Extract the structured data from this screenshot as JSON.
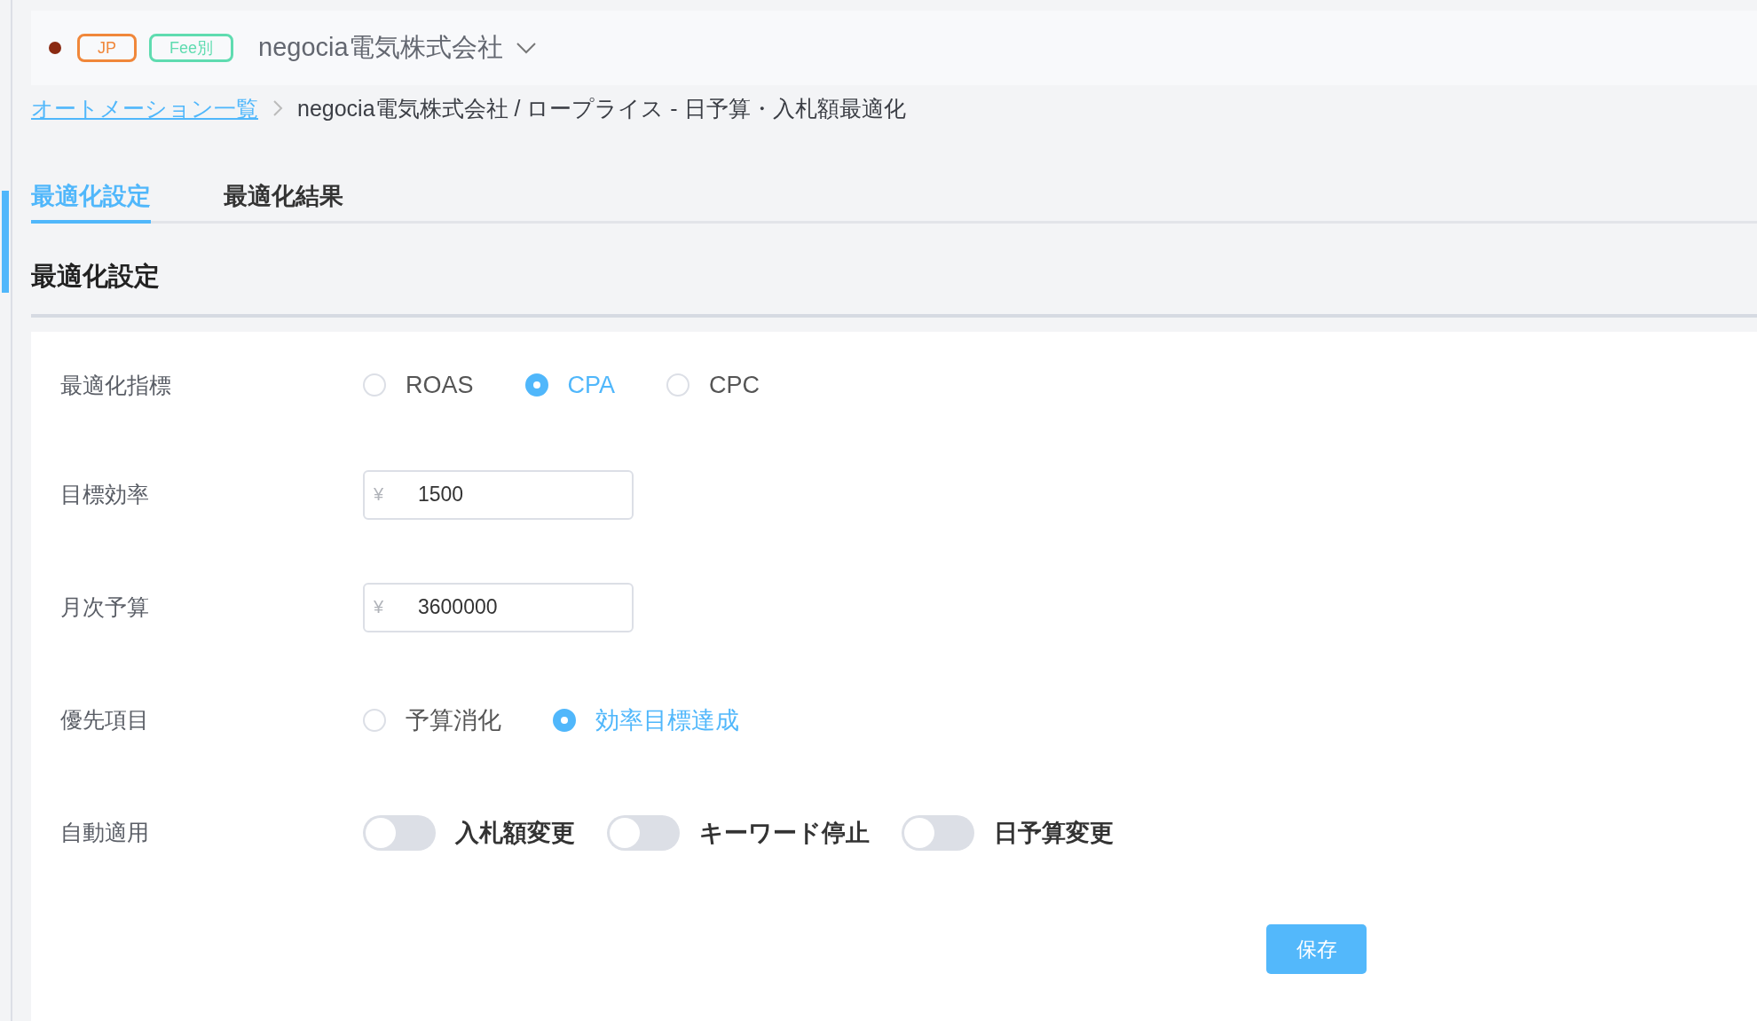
{
  "header": {
    "badges": [
      {
        "label": "JP",
        "color": "#f0873a"
      },
      {
        "label": "Fee別",
        "color": "#5fdcb0"
      }
    ],
    "account": "negocia電気株式会社"
  },
  "breadcrumb": {
    "link": "オートメーション一覧",
    "current": "negocia電気株式会社 / ロープライス - 日予算・入札額最適化"
  },
  "tabs": [
    {
      "label": "最適化設定",
      "selected": true
    },
    {
      "label": "最適化結果",
      "selected": false
    }
  ],
  "section_title": "最適化設定",
  "form": {
    "rows": [
      {
        "kind": "radio",
        "label": "最適化指標",
        "options": [
          {
            "label": "ROAS",
            "selected": false
          },
          {
            "label": "CPA",
            "selected": true
          },
          {
            "label": "CPC",
            "selected": false
          }
        ]
      },
      {
        "kind": "input",
        "label": "目標効率",
        "prefix": "¥",
        "value": "1500"
      },
      {
        "kind": "input",
        "label": "月次予算",
        "prefix": "¥",
        "value": "3600000"
      },
      {
        "kind": "radio",
        "label": "優先項目",
        "options": [
          {
            "label": "予算消化",
            "selected": false
          },
          {
            "label": "効率目標達成",
            "selected": true
          }
        ]
      },
      {
        "kind": "toggle",
        "label": "自動適用",
        "options": [
          {
            "label": "入札額変更",
            "on": false
          },
          {
            "label": "キーワード停止",
            "on": false
          },
          {
            "label": "日予算変更",
            "on": false
          }
        ]
      }
    ],
    "save_button": "保存"
  }
}
